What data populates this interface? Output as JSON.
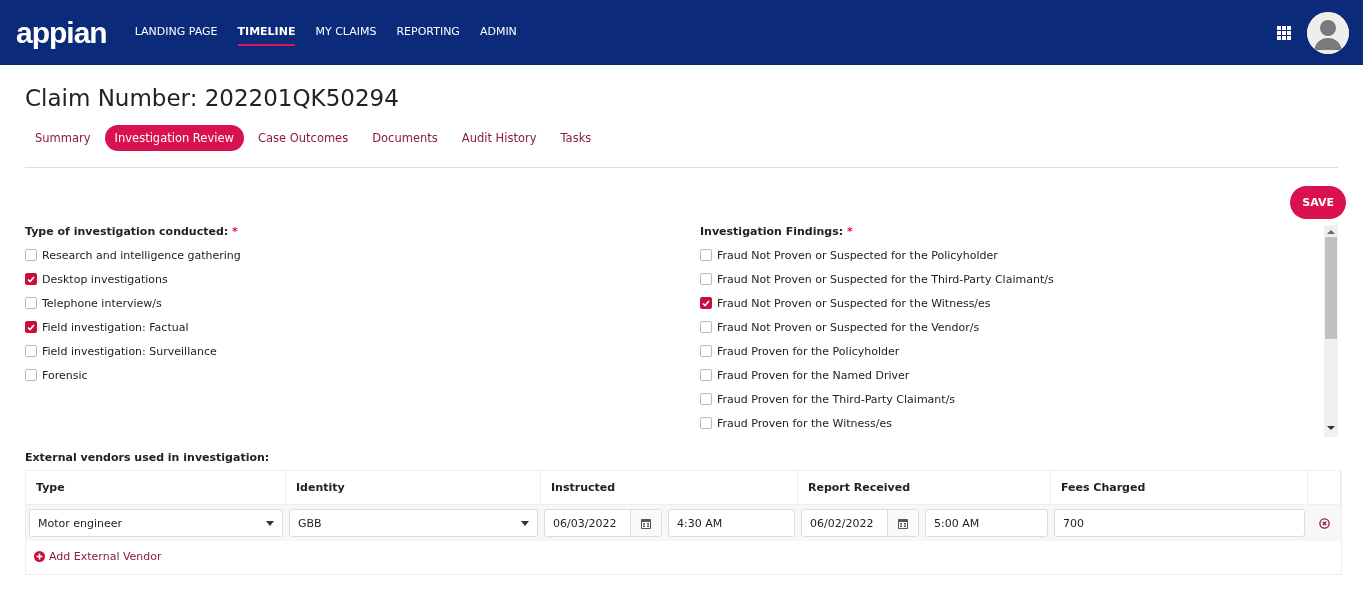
{
  "header": {
    "logo": "appian",
    "nav": [
      {
        "label": "LANDING PAGE",
        "selected": false
      },
      {
        "label": "TIMELINE",
        "selected": true
      },
      {
        "label": "MY CLAIMS",
        "selected": false
      },
      {
        "label": "REPORTING",
        "selected": false
      },
      {
        "label": "ADMIN",
        "selected": false
      }
    ]
  },
  "title": "Claim Number: 202201QK50294",
  "tabs": [
    {
      "label": "Summary",
      "selected": false
    },
    {
      "label": "Investigation Review",
      "selected": true
    },
    {
      "label": "Case Outcomes",
      "selected": false
    },
    {
      "label": "Documents",
      "selected": false
    },
    {
      "label": "Audit History",
      "selected": false
    },
    {
      "label": "Tasks",
      "selected": false
    }
  ],
  "save_button": "SAVE",
  "investigation_types": {
    "label": "Type of investigation conducted:",
    "required_mark": "*",
    "options": [
      {
        "label": "Research and intelligence gathering",
        "checked": false
      },
      {
        "label": "Desktop investigations",
        "checked": true
      },
      {
        "label": "Telephone interview/s",
        "checked": false
      },
      {
        "label": "Field investigation: Factual",
        "checked": true
      },
      {
        "label": "Field investigation: Surveillance",
        "checked": false
      },
      {
        "label": "Forensic",
        "checked": false
      }
    ]
  },
  "findings": {
    "label": "Investigation Findings:",
    "required_mark": "*",
    "options": [
      {
        "label": "Fraud Not Proven or Suspected for the Policyholder",
        "checked": false
      },
      {
        "label": "Fraud Not Proven or Suspected for the Third-Party Claimant/s",
        "checked": false
      },
      {
        "label": "Fraud Not Proven or Suspected for the Witness/es",
        "checked": true
      },
      {
        "label": "Fraud Not Proven or Suspected for the Vendor/s",
        "checked": false
      },
      {
        "label": "Fraud Proven for the Policyholder",
        "checked": false
      },
      {
        "label": "Fraud Proven for the Named Driver",
        "checked": false
      },
      {
        "label": "Fraud Proven for the Third-Party Claimant/s",
        "checked": false
      },
      {
        "label": "Fraud Proven for the Witness/es",
        "checked": false
      }
    ]
  },
  "vendors": {
    "label": "External vendors used in investigation:",
    "columns": [
      "Type",
      "Identity",
      "Instructed",
      "Report Received",
      "Fees Charged"
    ],
    "rows": [
      {
        "type": "Motor engineer",
        "identity": "GBB",
        "instructed_date": "06/03/2022",
        "instructed_time": "4:30 AM",
        "received_date": "06/02/2022",
        "received_time": "5:00 AM",
        "fees": "700"
      }
    ],
    "add_link": "Add External Vendor"
  }
}
